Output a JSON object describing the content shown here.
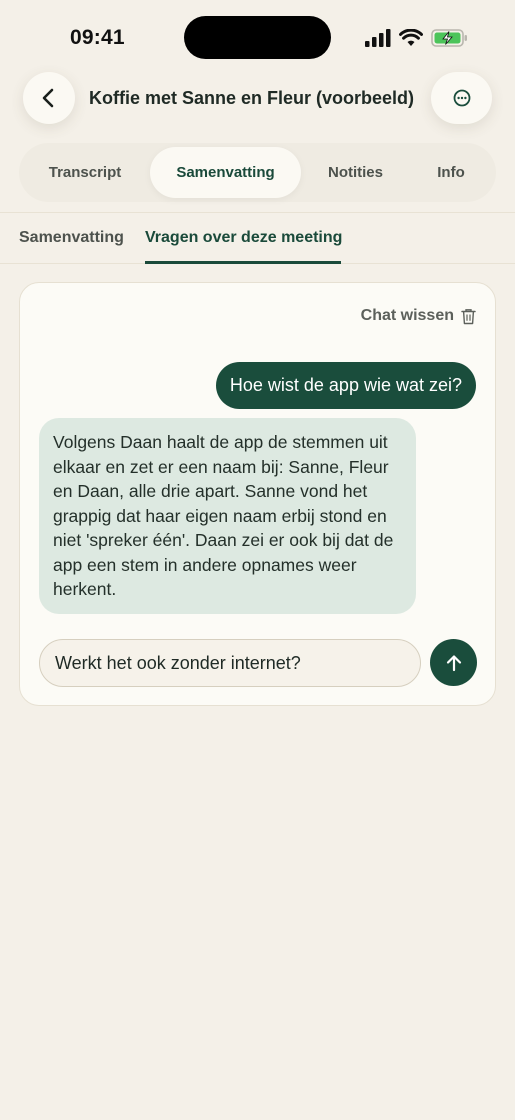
{
  "status_bar": {
    "time": "09:41"
  },
  "header": {
    "title": "Koffie met Sanne en Fleur (voorbeeld)"
  },
  "tabs": [
    {
      "label": "Transcript",
      "active": false
    },
    {
      "label": "Samenvatting",
      "active": true
    },
    {
      "label": "Notities",
      "active": false
    },
    {
      "label": "Info",
      "active": false
    }
  ],
  "subtabs": [
    {
      "label": "Samenvatting",
      "active": false
    },
    {
      "label": "Vragen over deze meeting",
      "active": true
    }
  ],
  "chat": {
    "clear_label": "Chat wissen",
    "user_message": "Hoe wist de app wie wat zei?",
    "bot_message": "Volgens Daan haalt de app de stemmen uit elkaar en zet er een naam bij: Sanne, Fleur en Daan, alle drie apart. Sanne vond het grappig dat haar eigen naam erbij stond en niet 'spreker één'. Daan zei er ook bij dat de app een stem in andere opnames weer herkent.",
    "input_value": "Werkt het ook zonder internet?"
  },
  "icons": {
    "back": "chevron-left-icon",
    "more": "more-horizontal-icon",
    "trash": "trash-icon",
    "send": "arrow-up-icon"
  },
  "colors": {
    "accent": "#1a4d3c",
    "background": "#f4f0e8",
    "bot_bubble": "#dde9e1"
  }
}
